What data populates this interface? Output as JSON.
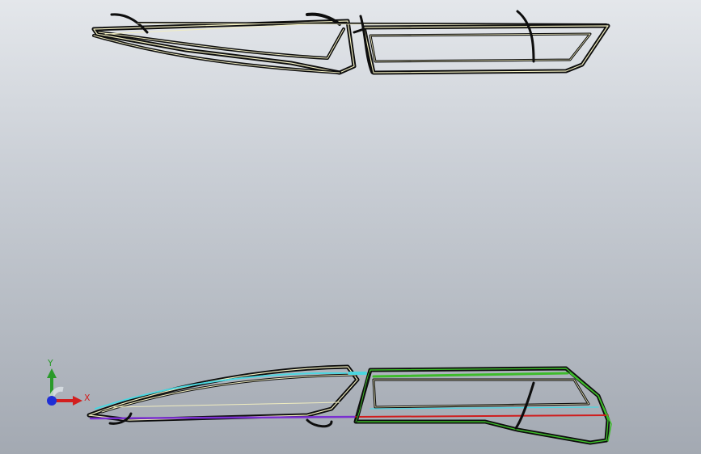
{
  "viewport": {
    "background_top": "#e4e7eb",
    "background_bottom": "#a3a9b2"
  },
  "models": {
    "top_frame": {
      "name": "door-frame-top-view",
      "color": "#0d0d0d",
      "edge_color": "#f0edc0"
    },
    "bottom_frame": {
      "name": "door-frame-bottom-view",
      "colors": [
        "#4bd6e0",
        "#3dbb2a",
        "#d01c1c",
        "#7a2fd0",
        "#f0edc0"
      ]
    }
  },
  "triad": {
    "x_label": "X",
    "y_label": "Y",
    "x_color": "#d21f1f",
    "y_color": "#2a9a2a",
    "z_color": "#1f2fd6",
    "icon": "coordinate-axes-icon"
  }
}
